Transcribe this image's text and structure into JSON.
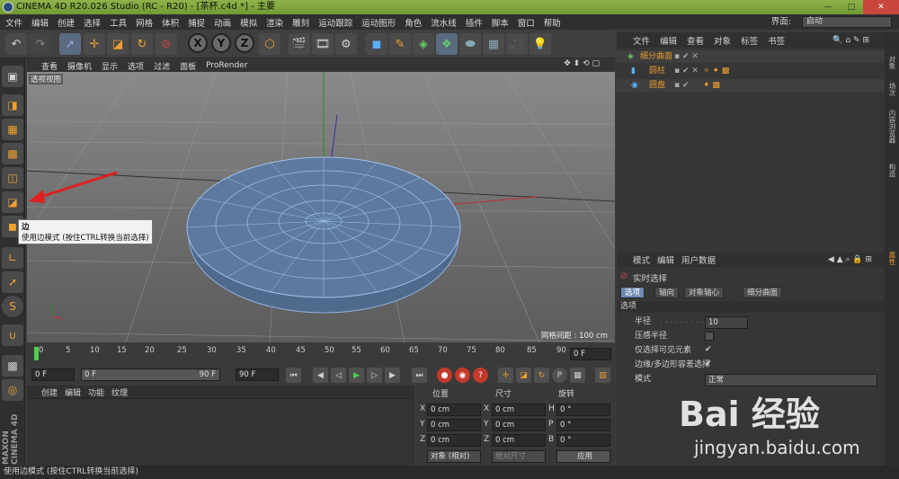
{
  "window": {
    "title": "CINEMA 4D R20.026 Studio (RC - R20) - [茶杯.c4d *] - 主要"
  },
  "menu": [
    "文件",
    "编辑",
    "创建",
    "选择",
    "工具",
    "网格",
    "体积",
    "捕捉",
    "动画",
    "模拟",
    "渲染",
    "雕刻",
    "运动跟踪",
    "运动图形",
    "角色",
    "流水线",
    "插件",
    "脚本",
    "窗口",
    "帮助"
  ],
  "layout": {
    "label": "界面:",
    "value": "启动"
  },
  "viewport": {
    "menu": [
      "查看",
      "摄像机",
      "显示",
      "选项",
      "过滤",
      "面板",
      "ProRender"
    ],
    "label": "透视视图",
    "grid_status": "网格间距 : 100 cm"
  },
  "tooltip": {
    "title": "边",
    "text": "使用边模式 (按住CTRL转换当前选择)"
  },
  "timeline": {
    "ticks": [
      "0",
      "5",
      "10",
      "15",
      "20",
      "25",
      "30",
      "35",
      "40",
      "45",
      "50",
      "55",
      "60",
      "65",
      "70",
      "75",
      "80",
      "85",
      "90"
    ],
    "end_field": "0 F"
  },
  "transport": {
    "start": "0 F",
    "range_start": "0 F",
    "range_end": "90 F",
    "end": "90 F"
  },
  "material_menu": [
    "创建",
    "编辑",
    "功能",
    "纹理"
  ],
  "coords": {
    "headers": [
      "位置",
      "尺寸",
      "旋转"
    ],
    "rows": [
      {
        "axis": "X",
        "pos": "0 cm",
        "saxis": "X",
        "size": "0 cm",
        "raxis": "H",
        "rot": "0 °"
      },
      {
        "axis": "Y",
        "pos": "0 cm",
        "saxis": "Y",
        "size": "0 cm",
        "raxis": "P",
        "rot": "0 °"
      },
      {
        "axis": "Z",
        "pos": "0 cm",
        "saxis": "Z",
        "size": "0 cm",
        "raxis": "B",
        "rot": "0 °"
      }
    ],
    "mode": "对象 (相对)",
    "size_mode": "绝对尺寸",
    "apply": "应用"
  },
  "object_manager": {
    "menu": [
      "文件",
      "编辑",
      "查看",
      "对象",
      "标签",
      "书签"
    ],
    "objects": [
      "细分曲面",
      "圆柱",
      "圆盘"
    ]
  },
  "attributes": {
    "menu": [
      "模式",
      "编辑",
      "用户数据"
    ],
    "tool": "实时选择",
    "tabs": [
      "选项",
      "轴向",
      "对象轴心",
      "细分曲面"
    ],
    "section": "选项",
    "rows": [
      {
        "label": "半径",
        "value": "10"
      },
      {
        "label": "压感半径",
        "value": ""
      },
      {
        "label": "仅选择可见元素",
        "value": "✔"
      },
      {
        "label": "边缘/多边形容差选择",
        "value": "✔"
      },
      {
        "label": "模式",
        "value": "正常"
      }
    ]
  },
  "side_tabs": [
    "对象",
    "场次",
    "内容浏览器",
    "构造"
  ],
  "side_tab_attr": "属性",
  "brand": "MAXON CINEMA 4D",
  "status": "使用边模式 (按住CTRL转换当前选择)",
  "watermark": {
    "main": "Bai 经验",
    "sub": "jingyan.baidu.com"
  }
}
